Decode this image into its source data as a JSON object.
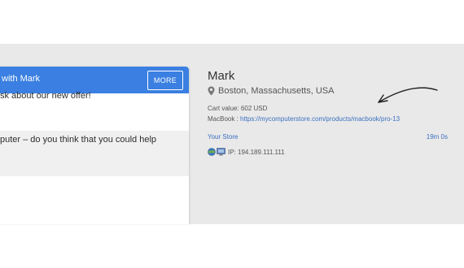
{
  "chat": {
    "title": "with Mark",
    "more_label": "MORE",
    "agent_message": "sk about our new offer!",
    "visitor_message": "puter – do you think that you could help"
  },
  "details": {
    "name": "Mark",
    "location": "Boston, Massachusetts, USA",
    "cart_label": "Cart value:",
    "cart_value": "602 USD",
    "product_label": "MacBook :",
    "product_url": "https://mycomputerstore.com/products/macbook/pro-13",
    "store": "Your Store",
    "time_on_site": "19m 0s",
    "ip_label": "IP:",
    "ip": "194.189.111.111"
  },
  "colors": {
    "header_blue": "#3a7fe1",
    "link_blue": "#3a6fc0",
    "panel_gray": "#e9e9e9"
  },
  "icons": [
    "location-pin-icon",
    "browser-globe-icon",
    "os-computer-icon",
    "annotation-arrow"
  ]
}
